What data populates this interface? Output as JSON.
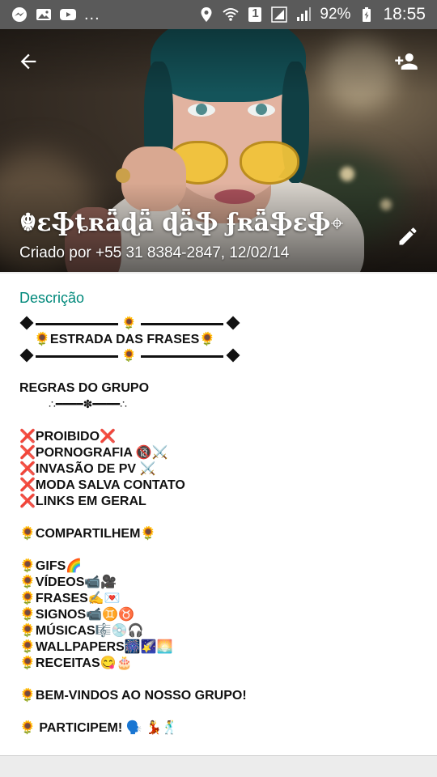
{
  "status_bar": {
    "notification_dots": "...",
    "battery_percent": "92%",
    "time": "18:55",
    "sim_badge": "1"
  },
  "header": {
    "group_name": "☬ɛֆȶʀǟɖǟ ɖǟֆ ʄʀǟֆɛֆ",
    "group_name_symbol": "⌖",
    "created_by": "Criado por +55 31 8384-2847, 12/02/14",
    "icons": [
      "arrow-back-icon",
      "person-add-icon",
      "pencil-icon"
    ]
  },
  "description": {
    "label": "Descrição",
    "title_line": "🌻ESTRADA DAS FRASES🌻",
    "divider_flower": "🌻",
    "rules_heading": "REGRAS DO GRUPO",
    "rules_ornament": "∴━━━━✽━━━━∴",
    "forbidden_heading": "❌PROIBIDO❌",
    "forbidden_items": [
      "❌PORNOGRAFIA 🔞⚔️",
      "❌INVASÃO DE PV ⚔️",
      "❌MODA SALVA CONTATO",
      "❌LINKS EM GERAL"
    ],
    "share_heading": "🌻COMPARTILHEM🌻",
    "share_items": [
      "🌻GIFS🌈",
      "🌻VÍDEOS📹🎥",
      "🌻FRASES✍️💌",
      "🌻SIGNOS📹♊♉",
      "🌻MÚSICAS🎼💿🎧",
      "🌻WALLPAPERS🎆🌠🌅",
      "🌻RECEITAS😋🎂"
    ],
    "welcome": "🌻BEM-VINDOS AO NOSSO GRUPO!",
    "participate": "🌻 PARTICIPEM! 🗣️ 💃🕺"
  }
}
